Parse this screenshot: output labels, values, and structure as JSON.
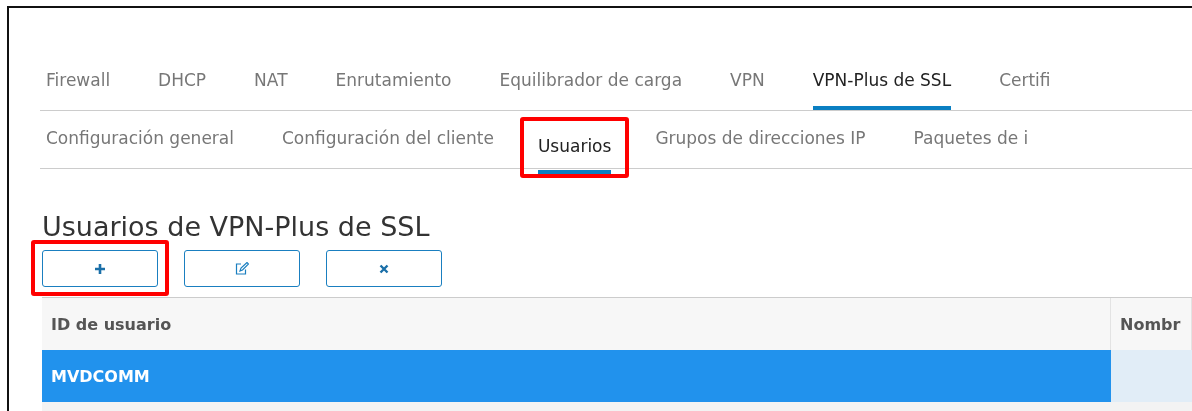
{
  "tabs": [
    {
      "label": "Firewall",
      "selected": false
    },
    {
      "label": "DHCP",
      "selected": false
    },
    {
      "label": "NAT",
      "selected": false
    },
    {
      "label": "Enrutamiento",
      "selected": false
    },
    {
      "label": "Equilibrador de carga",
      "selected": false
    },
    {
      "label": "VPN",
      "selected": false
    },
    {
      "label": "VPN-Plus de SSL",
      "selected": true
    },
    {
      "label": "Certifi",
      "selected": false
    }
  ],
  "subtabs": [
    {
      "label": "Configuración general",
      "selected": false,
      "highlighted": false
    },
    {
      "label": "Configuración del cliente",
      "selected": false,
      "highlighted": false
    },
    {
      "label": "Usuarios",
      "selected": true,
      "highlighted": true
    },
    {
      "label": "Grupos de direcciones IP",
      "selected": false,
      "highlighted": false
    },
    {
      "label": "Paquetes de i",
      "selected": false,
      "highlighted": false
    }
  ],
  "title": "Usuarios de VPN-Plus de SSL",
  "toolbar": [
    {
      "kind": "add",
      "highlighted": true
    },
    {
      "kind": "edit",
      "highlighted": false
    },
    {
      "kind": "delete",
      "highlighted": false
    }
  ],
  "table": {
    "columns": [
      "ID de usuario",
      "Nombr"
    ],
    "rows": [
      {
        "cells": [
          "MVDCOMM",
          ""
        ],
        "selected": true
      }
    ]
  }
}
